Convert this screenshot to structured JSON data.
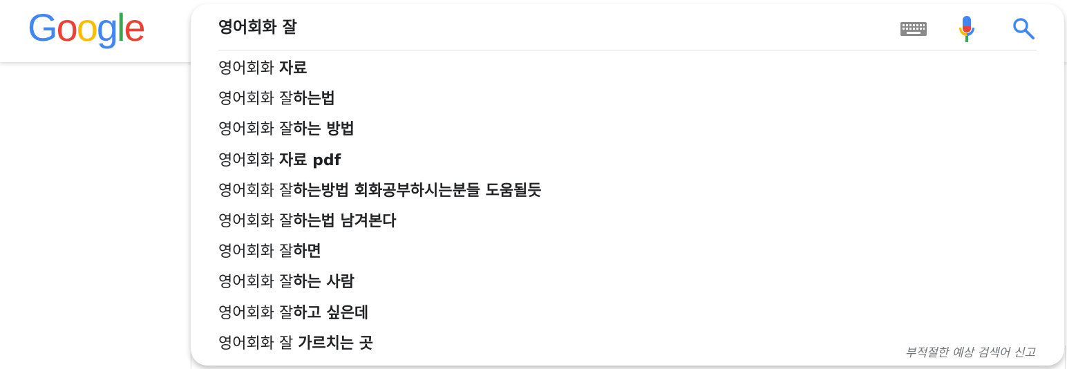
{
  "logo": {
    "letters": [
      "G",
      "o",
      "o",
      "g",
      "l",
      "e"
    ],
    "colors": [
      "#4285F4",
      "#EA4335",
      "#FBBC05",
      "#4285F4",
      "#34A853",
      "#EA4335"
    ]
  },
  "search": {
    "query": "영어회화 잘",
    "keyboard_icon": "keyboard-icon",
    "mic_icon": "microphone-icon",
    "search_icon": "search-icon",
    "accent_color": "#4285F4"
  },
  "suggestions": [
    {
      "prefix": "영어회화 ",
      "completion": "자료"
    },
    {
      "prefix": "영어회화 잘",
      "completion": "하는법"
    },
    {
      "prefix": "영어회화 잘",
      "completion": "하는 방법"
    },
    {
      "prefix": "영어회화 ",
      "completion": "자료 pdf"
    },
    {
      "prefix": "영어회화 잘",
      "completion": "하는방법 회화공부하시는분들 도움될듯"
    },
    {
      "prefix": "영어회화 잘",
      "completion": "하는법 남겨본다"
    },
    {
      "prefix": "영어회화 잘",
      "completion": "하면"
    },
    {
      "prefix": "영어회화 잘",
      "completion": "하는 사람"
    },
    {
      "prefix": "영어회화 잘",
      "completion": "하고 싶은데"
    },
    {
      "prefix": "영어회화 잘 ",
      "completion": "가르치는 곳"
    }
  ],
  "report_link": "부적절한 예상 검색어 신고"
}
